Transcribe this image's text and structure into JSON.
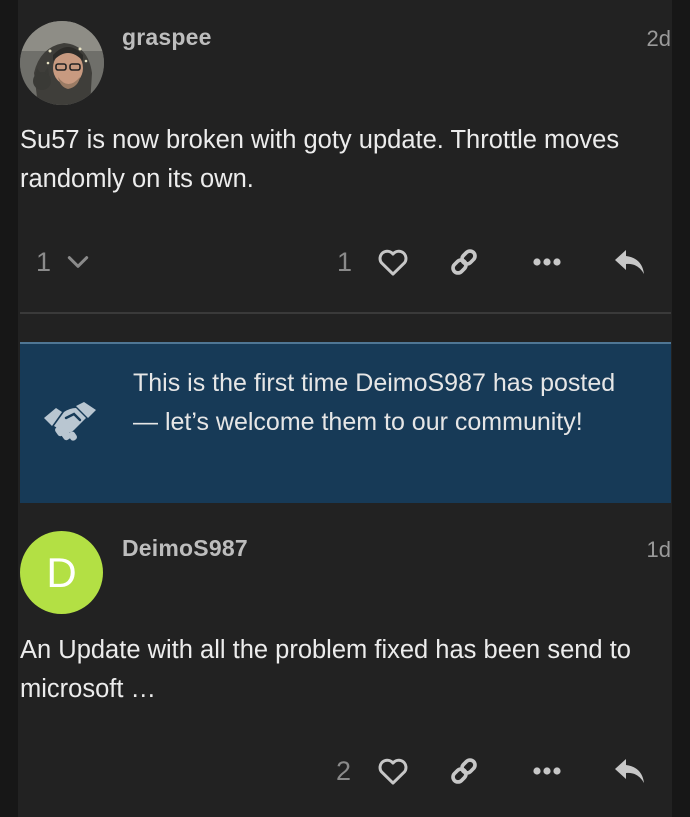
{
  "colors": {
    "page_bg": "#171717",
    "post_bg": "#222222",
    "notice_bg": "#173a57",
    "letter_avatar_bg": "#b3e044",
    "muted_text": "#8a8a8a",
    "icon_color": "#c7c7c7"
  },
  "posts": [
    {
      "username": "graspee",
      "date": "2d",
      "body": "Su57 is now broken with goty update. Throttle moves randomly on its own.",
      "replies_count": "1",
      "likes_count": "1"
    },
    {
      "username": "DeimoS987",
      "avatar_letter": "D",
      "date": "1d",
      "body": "An Update with all the problem fixed has been send to microsoft …",
      "likes_count": "2"
    }
  ],
  "welcome_notice": {
    "text": "This is the first time DeimoS987 has posted — let’s welcome them to our community!"
  },
  "icons": {
    "expand_replies": "chevron-down-icon",
    "like": "heart-icon",
    "copy_link": "link-icon",
    "more": "more-dots-icon",
    "reply": "reply-icon",
    "welcome": "handshake-icon"
  }
}
